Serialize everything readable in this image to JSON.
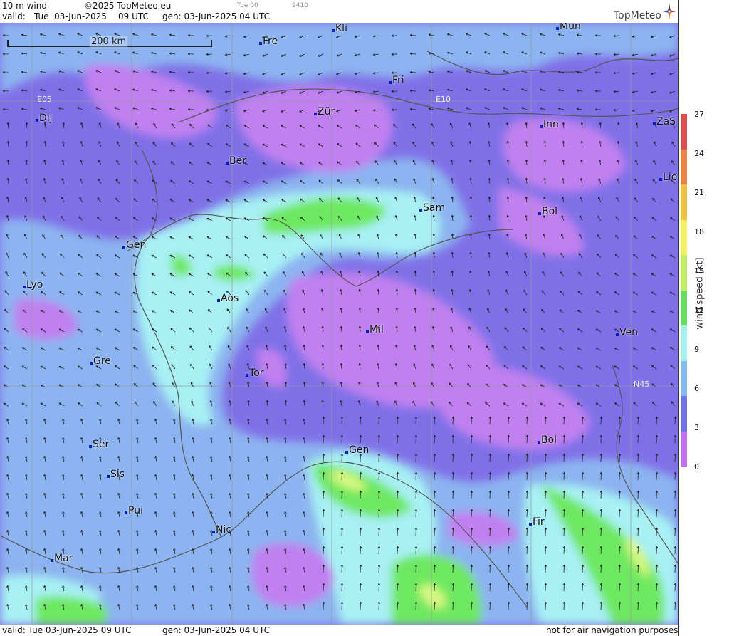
{
  "header": {
    "field": "10 m wind",
    "copyright": "©2025 TopMeteo.eu",
    "step": "Tue 00",
    "code": "9410",
    "valid_label": "valid:",
    "valid_day": "Tue",
    "valid_date": "03-Jun-2025",
    "valid_time": "09 UTC",
    "gen": "gen: 03-Jun-2025 04 UTC",
    "brand": "TopMeteo"
  },
  "scale": {
    "label": "200 km"
  },
  "grid_labels": {
    "lon_e05": "E05",
    "lon_e10": "E10",
    "lat_n45": "N45"
  },
  "cities": [
    {
      "label": "Fre"
    },
    {
      "label": "Kli"
    },
    {
      "label": "Mün"
    },
    {
      "label": "Fri"
    },
    {
      "label": "Dij"
    },
    {
      "label": "Zür"
    },
    {
      "label": "Inn"
    },
    {
      "label": "ZaS"
    },
    {
      "label": "Ber"
    },
    {
      "label": "Lie"
    },
    {
      "label": "Sam"
    },
    {
      "label": "Bol"
    },
    {
      "label": "Gen"
    },
    {
      "label": "Lyo"
    },
    {
      "label": "Aos"
    },
    {
      "label": "Mil"
    },
    {
      "label": "Ven"
    },
    {
      "label": "Gre"
    },
    {
      "label": "Tor"
    },
    {
      "label": "Ser"
    },
    {
      "label": "Gen"
    },
    {
      "label": "Bol"
    },
    {
      "label": "Sis"
    },
    {
      "label": "Pui"
    },
    {
      "label": "Fir"
    },
    {
      "label": "Nic"
    },
    {
      "label": "Mar"
    }
  ],
  "legend": {
    "title": "wind speed [kt]",
    "ticks": [
      "27",
      "24",
      "21",
      "18",
      "15",
      "12",
      "9",
      "6",
      "3",
      "0"
    ],
    "colors": [
      "#e05050",
      "#f08040",
      "#f0c040",
      "#f0f060",
      "#c0f060",
      "#60e060",
      "#a8f0f0",
      "#88b8f0",
      "#7070e8",
      "#c070f0"
    ]
  },
  "footer": {
    "valid": "valid:  Tue  03-Jun-2025  09 UTC",
    "gen": "gen: 03-Jun-2025 04 UTC",
    "disclaimer": "not for air navigation purposes"
  },
  "colors": {
    "calm": "#c080f0",
    "low": "#8070e8",
    "mid_low": "#8cb4f0",
    "mid": "#a8f0f4",
    "high": "#6ee860",
    "very_high": "#d8f880"
  }
}
